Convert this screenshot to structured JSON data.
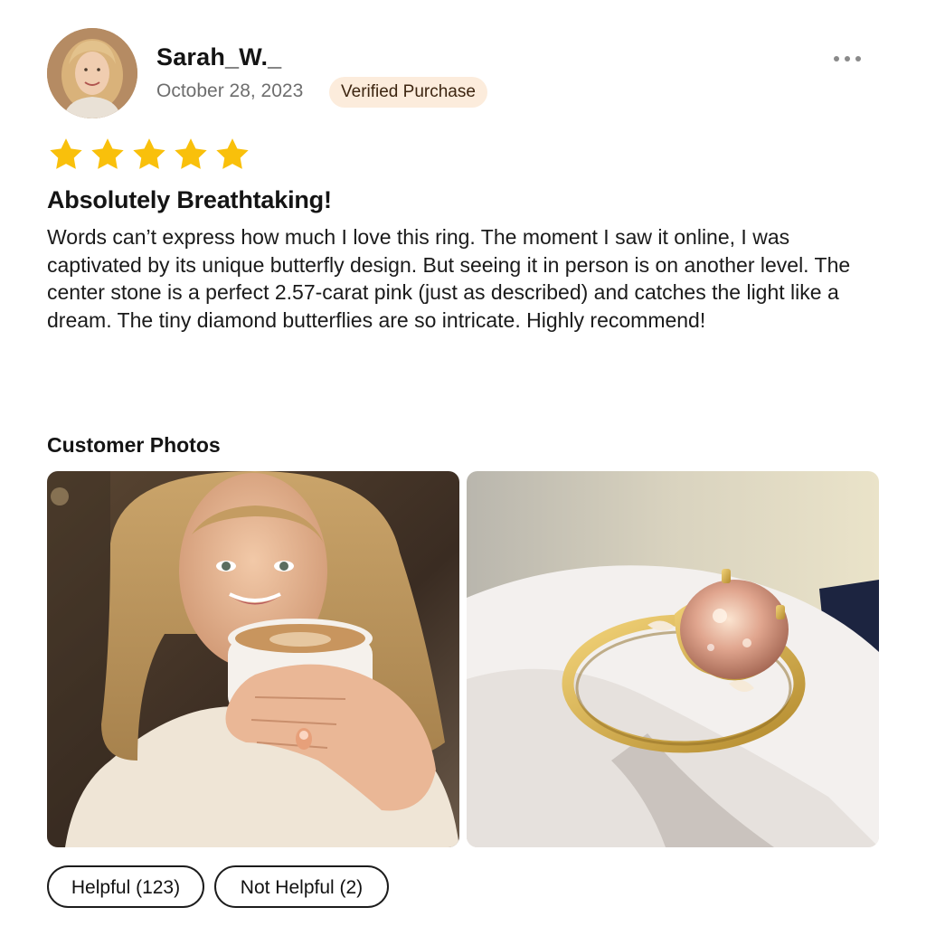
{
  "review": {
    "author": "Sarah_W._",
    "date": "October 28, 2023",
    "badge": "Verified Purchase",
    "rating": 5,
    "rating_max": 5,
    "title": "Absolutely Breathtaking!",
    "body": "Words can’t express how much I love this ring. The moment I saw it online, I was captivated by its unique butterfly design. But seeing it in person is on another level. The center stone is a perfect 2.57-carat pink (just as described) and catches the light like a dream. The tiny diamond butterflies are so intricate. Highly recommend!"
  },
  "photos": {
    "heading": "Customer Photos"
  },
  "actions": {
    "helpful_label": "Helpful (123)",
    "not_helpful_label": "Not Helpful (2)"
  },
  "icons": {
    "menu": "more-horizontal-icon",
    "star": "star-icon"
  },
  "colors": {
    "star": "#F9C00B",
    "badge_bg": "#FCECDC",
    "badge_text": "#3D2510",
    "meta_text": "#6E6E6E"
  }
}
